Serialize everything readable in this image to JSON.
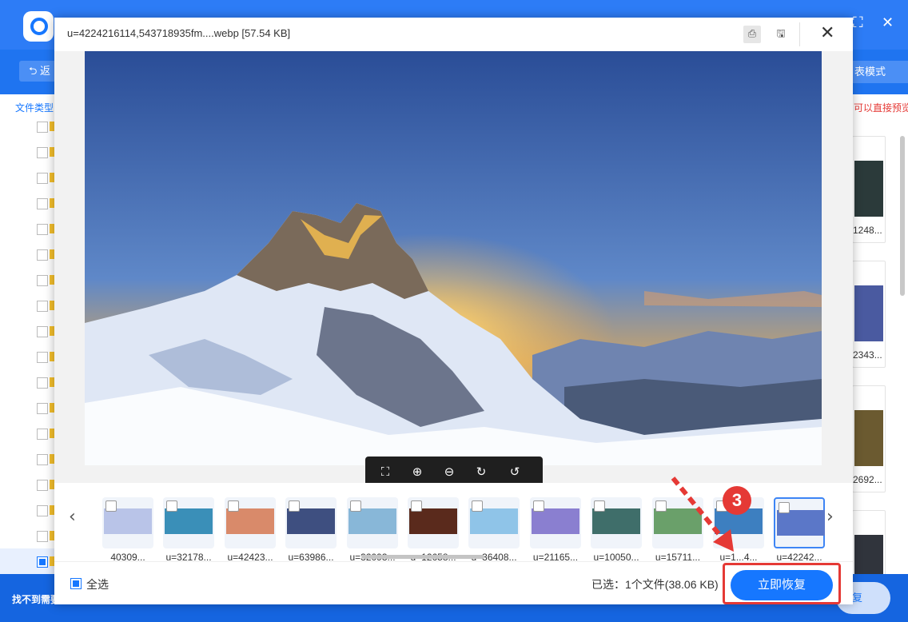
{
  "app": {
    "back_label": "返",
    "list_mode_label": "表模式",
    "file_type_label": "文件类型",
    "hint_text": "可以直接预览",
    "not_found_text": "找不到需要",
    "recover_bg_label": "复",
    "right_cards": [
      {
        "label": "1248..."
      },
      {
        "label": "2343..."
      },
      {
        "label": "2692..."
      },
      {
        "label": ""
      }
    ]
  },
  "dialog": {
    "title": "u=4224216114,543718935fm....webp [57.54 KB]",
    "icons": [
      "preview-icon",
      "save-icon"
    ],
    "close_label": "✕",
    "toolbar": [
      "fullscreen-icon",
      "zoom-in-icon",
      "zoom-out-icon",
      "rotate-right-icon",
      "rotate-left-icon"
    ],
    "thumbnails": [
      {
        "name": "40309...",
        "selected": false,
        "color": "#b9c4e8"
      },
      {
        "name": "u=32178...",
        "selected": false,
        "color": "#3a8fb8"
      },
      {
        "name": "u=42423...",
        "selected": false,
        "color": "#d98a6a"
      },
      {
        "name": "u=63986...",
        "selected": false,
        "color": "#3e4f80"
      },
      {
        "name": "u=32093...",
        "selected": false,
        "color": "#88b7d8"
      },
      {
        "name": "u=12658...",
        "selected": false,
        "color": "#5a2a1c"
      },
      {
        "name": "u=36408...",
        "selected": false,
        "color": "#8fc4e8"
      },
      {
        "name": "u=21165...",
        "selected": false,
        "color": "#8a7fd0"
      },
      {
        "name": "u=10050...",
        "selected": false,
        "color": "#3f6e6a"
      },
      {
        "name": "u=15711...",
        "selected": false,
        "color": "#6aa06a"
      },
      {
        "name": "u=1...4...",
        "selected": false,
        "color": "#3d7fc0"
      },
      {
        "name": "u=42242...",
        "selected": true,
        "color": "#5b77c8"
      }
    ],
    "footer": {
      "select_all_label": "全选",
      "selected_info": "已选：1个文件(38.06 KB)",
      "recover_label": "立即恢复"
    },
    "step_number": "3",
    "accent_color": "#1677ff",
    "highlight_color": "#e53935"
  }
}
